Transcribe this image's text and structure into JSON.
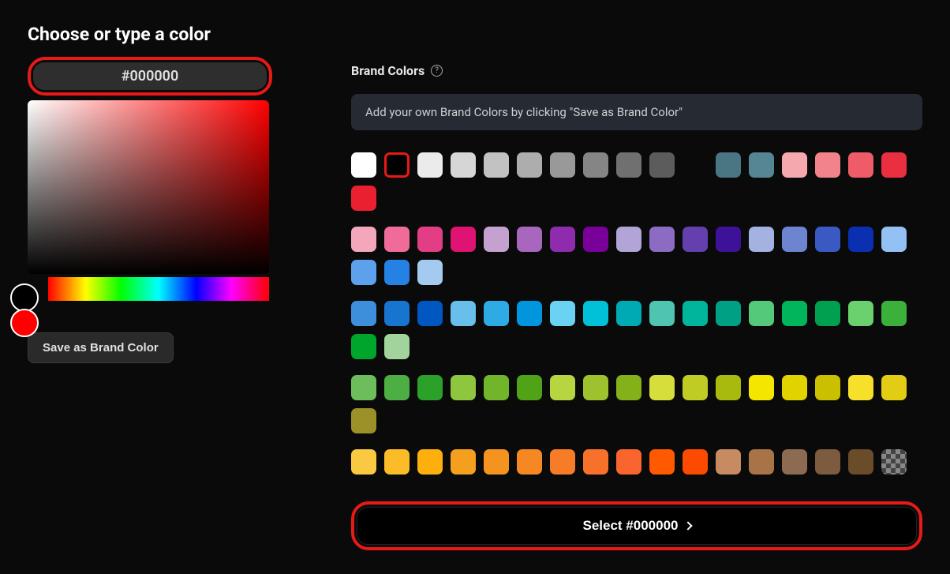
{
  "title": "Choose or type a color",
  "hexValue": "#000000",
  "previewCurrent": "#000000",
  "previewHue": "#ff0000",
  "saveBrandLabel": "Save as Brand Color",
  "brandSection": {
    "title": "Brand Colors",
    "hint": "Add your own Brand Colors by clicking \"Save as Brand Color\""
  },
  "selectButton": "Select #000000",
  "highlight": "#e91916",
  "palette": [
    [
      "#ffffff",
      "#000000",
      "#ebebeb",
      "#d6d6d6",
      "#c2c2c2",
      "#adadad",
      "#999999",
      "#858585",
      "#707070",
      "#5c5c5c",
      "#474747",
      "#333333",
      "SPACER",
      "#00374a",
      "#004d65",
      "#016e8f",
      "#008cb4",
      "#00a1d8",
      "#01c7fc",
      "#52d6fc",
      "#93e3fd",
      "#cbf0ff"
    ],
    [
      "#f4a6bb",
      "#ef5b92",
      "#e93578",
      "#de0f6a",
      "#c20c5e",
      "#a60a52",
      "#e19fca",
      "#cf66af",
      "#bc3099",
      "#a50085",
      "#8b0071",
      "#72005e",
      "#cda4d4",
      "#b46dbd",
      "#9a36a7",
      "#82008f",
      "#6f007b",
      "#5c0067",
      "#bba6d4",
      "#8e6cbf",
      "#6436a9",
      "#370091",
      "#2e0079",
      "#260063",
      "#a6aad4",
      "#6d74c0",
      "#3641ab",
      "#061493",
      "#05117a",
      "#040e63",
      "#a5c2e4",
      "#6f9ed1",
      "#397bbe",
      "#004fad",
      "#003f8c",
      "#002e6b"
    ],
    [
      "#f6d6a3",
      "#f2b26d",
      "#ee8e38",
      "#e96400",
      "#c25500",
      "#9c4700",
      "#fae1a7",
      "#f7cd71",
      "#f4b93c",
      "#f09c00",
      "#c98300",
      "#a26a00",
      "#fdf2a9",
      "#fcea73",
      "#fae33d",
      "#f7d500",
      "#d0b200",
      "#a89000",
      "#f0edad",
      "#e7e17b",
      "#ded549",
      "#d4cb16",
      "#b1a911",
      "#8d870d",
      "#d0e3a8",
      "#b6d273",
      "#9cc03e",
      "#80af06",
      "#6b9205",
      "#557504",
      "#adddb5",
      "#7fca89",
      "#51b85c",
      "#1fa52c",
      "#198a24",
      "#146f1d"
    ],
    [
      "#c5d1a2",
      "#a5ba6c",
      "#84a336",
      "#618a00",
      "#517300",
      "#415c00",
      "#b8ded2",
      "#8fcbb8",
      "#67b89e",
      "#3ca384",
      "#328a6f",
      "#286f59",
      "#a3e0e4",
      "#6dced5",
      "#38bcc6",
      "#00aab5",
      "#008e97",
      "#007279",
      "#a1d5e0",
      "#6bbed0",
      "#35a7c1",
      "#008bb0",
      "#007493",
      "#005d76",
      "#bdb6a2",
      "#9c916c",
      "#7a6d36",
      "#594900",
      "#4b3d00",
      "#3c3100",
      "#d3a49d",
      "#be746a",
      "#a94437",
      "#921500",
      "#7a1200",
      "#620e00",
      "TRANS"
    ]
  ],
  "paletteFlattened": [
    "#ffffff",
    "#000000",
    "#ebebeb",
    "#d6d6d6",
    "#c2c2c2",
    "#adadad",
    "#999999",
    "#858585",
    "#707070",
    "#5c5c5c",
    "#474747",
    "#333333",
    "SPACER",
    "#4a7a85",
    "#568b97",
    "#f3a3ab",
    "#f27784",
    "#ee4c5d",
    "#ea1f35",
    "#ea1f35",
    "#f4a6bb",
    "#ef5b92",
    "#e93578",
    "#de0f6a",
    "#cf66af",
    "#bc3099",
    "#a50085",
    "#b46dbd",
    "#9a36a7",
    "#82008f",
    "#8e6cbf",
    "#6436a9",
    "#370091",
    "#6d74c0",
    "#3641ab",
    "#061493",
    "#6f9ed1",
    "#397bbe",
    "#004fad",
    "#a5c2e4",
    "#3d99d6",
    "#1a7fd4",
    "#0062d1",
    "#68b9e4",
    "#00aeee",
    "#2ec5f4",
    "#52d6fc",
    "#4fc2c2",
    "#3cc7c7",
    "#00c7c7",
    "#4fbda6",
    "#00c29c",
    "#00b28f",
    "#55c97a",
    "#00b55c",
    "#6ad16e",
    "#a3d39c",
    "#6ab04c",
    "#4daf43",
    "#3bb03b",
    "#2eaf20",
    "#8ec73e",
    "#a8d441",
    "#c0db3a",
    "#dbe236",
    "#f5e600",
    "#f7e02a",
    "#f9e95f",
    "#fde99a",
    "#fbd24b",
    "#fad975",
    "#f0c030",
    "#f9b342",
    "#fca728",
    "#fd9a0d",
    "#f38f1e",
    "#f38121",
    "#f47624",
    "#f56c28",
    "#f8602b",
    "#f9542f",
    "#ff4a00",
    "#fc4b00",
    "#c78b62",
    "#a97348",
    "#7c5b3e",
    "#8c6b52",
    "TRANS"
  ],
  "rows": [
    [
      "#ffffff",
      "SELECTED#000000",
      "#ebebeb",
      "#d6d6d6",
      "#c2c2c2",
      "#adadad",
      "#999999",
      "#858585",
      "#707070",
      "#5c5c5c",
      "SPACER",
      "#4a7583",
      "#568693",
      "#f5a9af",
      "#f2838c",
      "#ee5c69",
      "#ea2f41",
      "#ea1f2f"
    ],
    [
      "#f4a6bb",
      "#ef6c9a",
      "#e23d85",
      "#de1373",
      "#c5a1d0",
      "#a866bf",
      "#8e2cad",
      "#7a009a",
      "#b2a4d6",
      "#8b6cc2",
      "#643fae",
      "#3d1299",
      "#a3b2e0",
      "#6d85d1",
      "#3a59c2",
      "#0a30b1",
      "#93c1f4",
      "#5da1ec",
      "#2681e4",
      "#a5caf0"
    ],
    [
      "#3d8fdc",
      "#1775d0",
      "#0057c2",
      "#68bfeb",
      "#2eaae4",
      "#0095dc",
      "#6ad3f4",
      "#00c1d8",
      "#00aab5",
      "#4fc4b0",
      "#00b59c",
      "#00a085",
      "#55c97a",
      "#00b55c",
      "#00a050",
      "#6ad16e",
      "#3bb03b",
      "#00a52c",
      "#a3d39c"
    ],
    [
      "#6ebd5c",
      "#4daf43",
      "#2ca12a",
      "#8ec73e",
      "#70b52a",
      "#50a316",
      "#b7d441",
      "#9dc22d",
      "#84b019",
      "#d5de3a",
      "#bfcc24",
      "#a8ba0e",
      "#f5e600",
      "#e0d300",
      "#cac000",
      "#f7e02a",
      "#e2cd14",
      "#9b9128"
    ],
    [
      "#f9c942",
      "#fcbc28",
      "#fdaf0d",
      "#f49f1e",
      "#f59321",
      "#f68824",
      "#f77c28",
      "#f8712b",
      "#f9652f",
      "#ff5a00",
      "#fc4b00",
      "#c78b62",
      "#a97348",
      "#8c6b52",
      "#7c5b3e",
      "#6b4c2a",
      "TRANS"
    ]
  ]
}
